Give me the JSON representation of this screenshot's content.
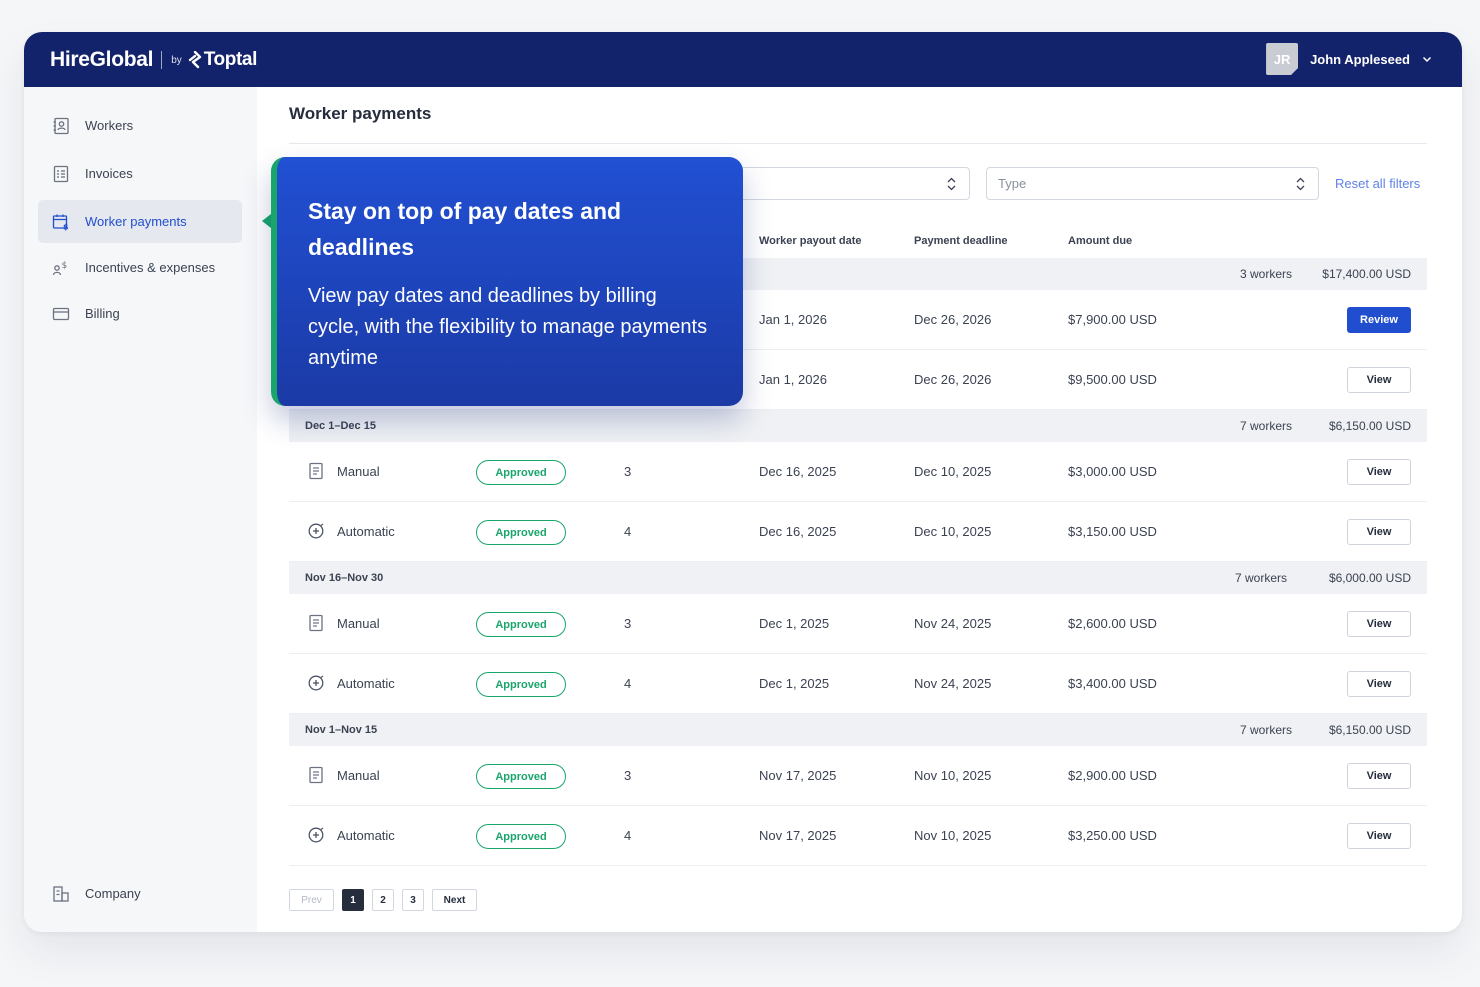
{
  "brand": {
    "name": "HireGlobal",
    "by": "by",
    "partner": "Toptal"
  },
  "user": {
    "initials": "JR",
    "name": "John Appleseed"
  },
  "sidebar": {
    "items": [
      {
        "label": "Workers",
        "icon": "contact-book-icon"
      },
      {
        "label": "Invoices",
        "icon": "invoice-document-icon"
      },
      {
        "label": "Worker payments",
        "icon": "payment-calendar-icon",
        "active": true
      },
      {
        "label": "Incentives & expenses",
        "icon": "person-dollar-icon"
      },
      {
        "label": "Billing",
        "icon": "credit-card-icon"
      }
    ],
    "bottom": {
      "label": "Company",
      "icon": "building-icon"
    }
  },
  "page": {
    "title": "Worker payments"
  },
  "filters": {
    "type_placeholder": "Type",
    "reset_label": "Reset all filters"
  },
  "table": {
    "headers": {
      "payout": "Worker payout date",
      "deadline": "Payment deadline",
      "amount": "Amount due"
    },
    "groups": [
      {
        "title": "",
        "workers": "3 workers",
        "total": "$17,400.00 USD",
        "rows": [
          {
            "type": "",
            "status": "",
            "count": "",
            "payout": "Jan 1,  2026",
            "deadline": "Dec 26,  2026",
            "amount": "$7,900.00 USD",
            "action": "Review",
            "primary": true
          },
          {
            "type": "",
            "status": "",
            "count": "",
            "payout": "Jan 1,  2026",
            "deadline": "Dec 26,  2026",
            "amount": "$9,500.00 USD",
            "action": "View"
          }
        ]
      },
      {
        "title": "Dec 1–Dec 15",
        "workers": "7 workers",
        "total": "$6,150.00 USD",
        "rows": [
          {
            "type": "Manual",
            "status": "Approved",
            "count": "3",
            "payout": "Dec 16, 2025",
            "deadline": "Dec 10, 2025",
            "amount": "$3,000.00 USD",
            "action": "View"
          },
          {
            "type": "Automatic",
            "status": "Approved",
            "count": "4",
            "payout": "Dec 16, 2025",
            "deadline": "Dec 10, 2025",
            "amount": "$3,150.00 USD",
            "action": "View"
          }
        ]
      },
      {
        "title": "Nov 16–Nov 30",
        "workers": "7 workers",
        "total": "$6,000.00 USD",
        "rows": [
          {
            "type": "Manual",
            "status": "Approved",
            "count": "3",
            "payout": "Dec 1, 2025",
            "deadline": "Nov 24, 2025",
            "amount": "$2,600.00 USD",
            "action": "View"
          },
          {
            "type": "Automatic",
            "status": "Approved",
            "count": "4",
            "payout": "Dec 1, 2025",
            "deadline": "Nov 24, 2025",
            "amount": "$3,400.00 USD",
            "action": "View"
          }
        ]
      },
      {
        "title": "Nov 1–Nov 15",
        "workers": "7 workers",
        "total": "$6,150.00 USD",
        "rows": [
          {
            "type": "Manual",
            "status": "Approved",
            "count": "3",
            "payout": "Nov 17, 2025",
            "deadline": "Nov 10, 2025",
            "amount": "$2,900.00 USD",
            "action": "View"
          },
          {
            "type": "Automatic",
            "status": "Approved",
            "count": "4",
            "payout": "Nov 17, 2025",
            "deadline": "Nov 10, 2025",
            "amount": "$3,250.00 USD",
            "action": "View"
          }
        ]
      }
    ]
  },
  "pagination": {
    "prev": "Prev",
    "pages": [
      "1",
      "2",
      "3"
    ],
    "current": "1",
    "next": "Next"
  },
  "callout": {
    "title": "Stay on top of pay dates and deadlines",
    "body": "View pay dates and deadlines by billing cycle, with the flexibility to manage payments anytime"
  },
  "colors": {
    "topbar": "#13236b",
    "accent": "#204ecf",
    "success": "#1aa56b",
    "callout": "#2150d3"
  }
}
